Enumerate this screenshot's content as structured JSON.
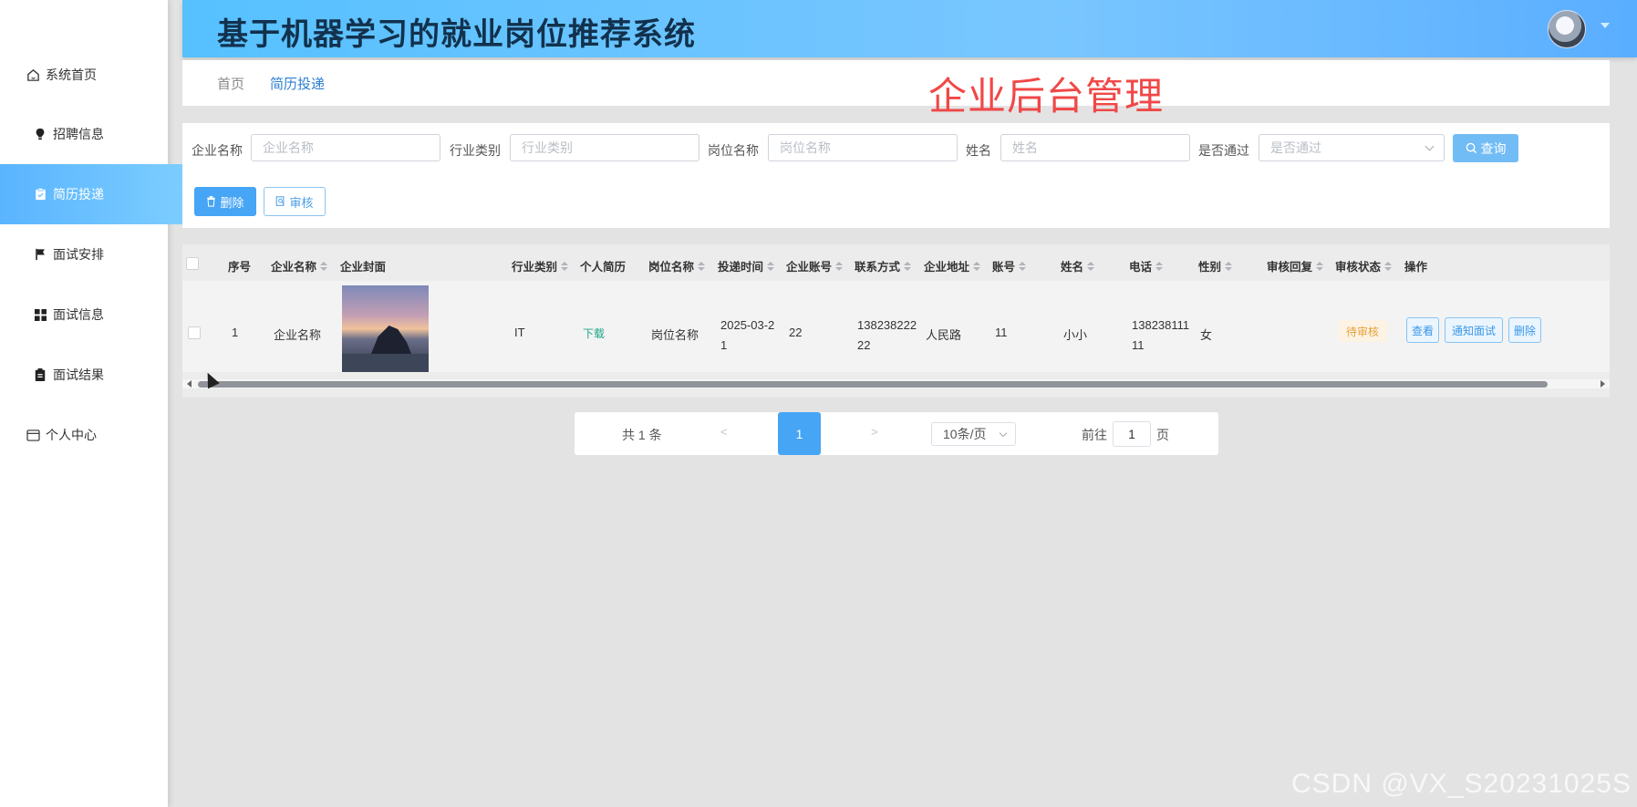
{
  "header": {
    "title": "基于机器学习的就业岗位推荐系统"
  },
  "overlay_title": "企业后台管理",
  "sidebar": {
    "items": [
      {
        "label": "系统首页",
        "icon": "home-icon"
      },
      {
        "label": "招聘信息",
        "icon": "lightbulb-icon"
      },
      {
        "label": "简历投递",
        "icon": "clipboard-icon",
        "active": true
      },
      {
        "label": "面试安排",
        "icon": "flag-icon"
      },
      {
        "label": "面试信息",
        "icon": "grid-icon"
      },
      {
        "label": "面试结果",
        "icon": "document-icon"
      },
      {
        "label": "个人中心",
        "icon": "card-icon"
      }
    ]
  },
  "breadcrumb": {
    "home": "首页",
    "current": "简历投递"
  },
  "search": {
    "company_label": "企业名称",
    "company_placeholder": "企业名称",
    "industry_label": "行业类别",
    "industry_placeholder": "行业类别",
    "position_label": "岗位名称",
    "position_placeholder": "岗位名称",
    "name_label": "姓名",
    "name_placeholder": "姓名",
    "passed_label": "是否通过",
    "passed_placeholder": "是否通过",
    "query_button": "查询"
  },
  "actions": {
    "delete": "删除",
    "review": "审核"
  },
  "table": {
    "headers": {
      "index": "序号",
      "company": "企业名称",
      "cover": "企业封面",
      "industry": "行业类别",
      "resume": "个人简历",
      "position": "岗位名称",
      "time": "投递时间",
      "account": "企业账号",
      "contact": "联系方式",
      "address": "企业地址",
      "user": "账号",
      "name": "姓名",
      "phone": "电话",
      "gender": "性别",
      "reply": "审核回复",
      "status": "审核状态",
      "ops": "操作"
    },
    "rows": [
      {
        "index": "1",
        "company": "企业名称",
        "industry": "IT",
        "resume": "下载",
        "position": "岗位名称",
        "time_line1": "2025-03-2",
        "time_line2": "1",
        "account": "22",
        "contact_line1": "138238222",
        "contact_line2": "22",
        "address": "人民路",
        "user": "11",
        "name": "小小",
        "phone_line1": "138238111",
        "phone_line2": "11",
        "gender": "女",
        "reply": "",
        "status": "待审核",
        "ops": {
          "view": "查看",
          "notify": "通知面试",
          "delete": "删除"
        }
      }
    ]
  },
  "pagination": {
    "total": "共 1 条",
    "prev": "<",
    "current": "1",
    "next": ">",
    "page_size": "10条/页",
    "goto": "前往",
    "goto_value": "1",
    "page_unit": "页"
  },
  "watermark": "CSDN @VX_S20231025S"
}
